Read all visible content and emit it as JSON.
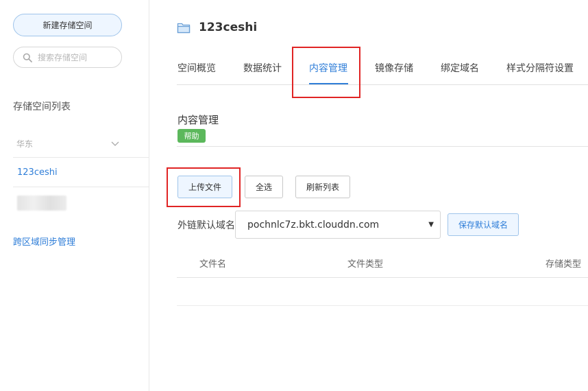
{
  "sidebar": {
    "new_bucket_label": "新建存储空间",
    "search_placeholder": "搜索存储空间",
    "list_title": "存储空间列表",
    "region_label": "华东",
    "bucket_name": "123ceshi",
    "cross_region_label": "跨区域同步管理"
  },
  "header": {
    "title": "123ceshi"
  },
  "tabs": [
    {
      "label": "空间概览"
    },
    {
      "label": "数据统计"
    },
    {
      "label": "内容管理"
    },
    {
      "label": "镜像存储"
    },
    {
      "label": "绑定域名"
    },
    {
      "label": "样式分隔符设置"
    }
  ],
  "content": {
    "section_title": "内容管理",
    "help_label": "帮助",
    "upload_label": "上传文件",
    "select_all_label": "全选",
    "refresh_label": "刷新列表",
    "domain_label": "外链默认域名",
    "domain_value": "pochnlc7z.bkt.clouddn.com",
    "save_domain_label": "保存默认域名",
    "columns": [
      "文件名",
      "文件类型",
      "存储类型"
    ]
  },
  "colors": {
    "accent": "#2f7ed8",
    "help_badge": "#5cb85c",
    "highlight_box": "#e02424"
  }
}
